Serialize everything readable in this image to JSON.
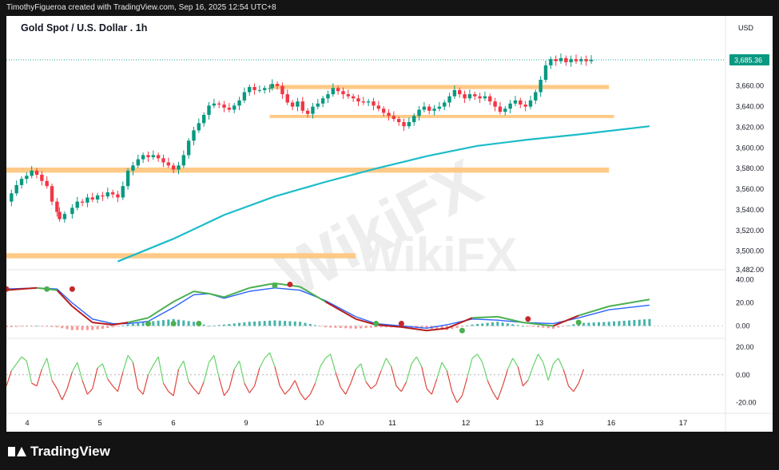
{
  "header": {
    "attribution": "TimothyFigueroa created with TradingView.com, Sep 16, 2025 12:54 UTC+8"
  },
  "footer": {
    "brand": "TradingView"
  },
  "watermark": {
    "text": "WikiFX"
  },
  "chart_data": [
    {
      "type": "candlestick",
      "title": "Gold Spot / U.S. Dollar . 1h",
      "currency_label": "USD",
      "ylim": [
        3482,
        3700
      ],
      "y_ticks": [
        "3,660.00",
        "3,640.00",
        "3,620.00",
        "3,600.00",
        "3,580.00",
        "3,560.00",
        "3,540.00",
        "3,520.00",
        "3,500.00",
        "3,482.00"
      ],
      "last_price": "3,685.36",
      "last_price_value": 3685.36,
      "x_ticks": [
        "4",
        "5",
        "6",
        "9",
        "10",
        "11",
        "12",
        "13",
        "16",
        "17"
      ],
      "xlim": [
        3.7,
        17.9
      ],
      "zones": [
        {
          "x_from": 8.9,
          "x_to": 15.6,
          "y_low": 3657,
          "y_high": 3661,
          "color": "#ffc47a"
        },
        {
          "x_from": 8.9,
          "x_to": 15.7,
          "y_low": 3629,
          "y_high": 3632,
          "color": "#ffc47a"
        },
        {
          "x_from": 3.7,
          "x_to": 15.6,
          "y_low": 3576,
          "y_high": 3581,
          "color": "#ffc47a"
        },
        {
          "x_from": 3.7,
          "x_to": 10.6,
          "y_low": 3493,
          "y_high": 3498,
          "color": "#ffc47a"
        }
      ],
      "moving_average": {
        "color": "#1bbcc8",
        "points": [
          [
            5.9,
            3490
          ],
          [
            7,
            3512
          ],
          [
            8,
            3535
          ],
          [
            9,
            3553
          ],
          [
            10,
            3567
          ],
          [
            11,
            3580
          ],
          [
            12,
            3592
          ],
          [
            13,
            3602
          ],
          [
            14,
            3608
          ],
          [
            15,
            3613
          ],
          [
            16.4,
            3621
          ]
        ]
      },
      "price_path": [
        [
          3.7,
          3548
        ],
        [
          3.8,
          3556
        ],
        [
          3.9,
          3564
        ],
        [
          4.0,
          3570
        ],
        [
          4.1,
          3573
        ],
        [
          4.2,
          3578
        ],
        [
          4.3,
          3574
        ],
        [
          4.4,
          3568
        ],
        [
          4.5,
          3563
        ],
        [
          4.6,
          3548
        ],
        [
          4.7,
          3538
        ],
        [
          4.75,
          3531
        ],
        [
          4.85,
          3536
        ],
        [
          5.0,
          3542
        ],
        [
          5.1,
          3548
        ],
        [
          5.2,
          3547
        ],
        [
          5.3,
          3552
        ],
        [
          5.4,
          3550
        ],
        [
          5.5,
          3554
        ],
        [
          5.6,
          3553
        ],
        [
          5.7,
          3557
        ],
        [
          5.8,
          3555
        ],
        [
          5.9,
          3552
        ],
        [
          6.0,
          3563
        ],
        [
          6.1,
          3578
        ],
        [
          6.2,
          3583
        ],
        [
          6.3,
          3589
        ],
        [
          6.4,
          3593
        ],
        [
          6.5,
          3591
        ],
        [
          6.6,
          3593
        ],
        [
          6.7,
          3590
        ],
        [
          6.8,
          3586
        ],
        [
          6.9,
          3583
        ],
        [
          7.0,
          3579
        ],
        [
          7.1,
          3583
        ],
        [
          7.2,
          3593
        ],
        [
          7.3,
          3607
        ],
        [
          7.4,
          3617
        ],
        [
          7.5,
          3624
        ],
        [
          7.6,
          3632
        ],
        [
          7.7,
          3641
        ],
        [
          7.8,
          3643
        ],
        [
          7.9,
          3642
        ],
        [
          8.0,
          3639
        ],
        [
          8.1,
          3637
        ],
        [
          8.2,
          3641
        ],
        [
          8.3,
          3646
        ],
        [
          8.4,
          3654
        ],
        [
          8.5,
          3659
        ],
        [
          8.6,
          3656
        ],
        [
          8.7,
          3656
        ],
        [
          8.8,
          3658
        ],
        [
          8.9,
          3658
        ],
        [
          8.95,
          3662
        ],
        [
          9.05,
          3660
        ],
        [
          9.15,
          3652
        ],
        [
          9.25,
          3644
        ],
        [
          9.35,
          3640
        ],
        [
          9.45,
          3645
        ],
        [
          9.55,
          3636
        ],
        [
          9.65,
          3633
        ],
        [
          9.75,
          3640
        ],
        [
          9.85,
          3643
        ],
        [
          9.95,
          3648
        ],
        [
          10.05,
          3652
        ],
        [
          10.15,
          3658
        ],
        [
          10.25,
          3655
        ],
        [
          10.35,
          3652
        ],
        [
          10.45,
          3650
        ],
        [
          10.55,
          3648
        ],
        [
          10.65,
          3645
        ],
        [
          10.75,
          3644
        ],
        [
          10.85,
          3645
        ],
        [
          10.95,
          3641
        ],
        [
          11.05,
          3638
        ],
        [
          11.15,
          3634
        ],
        [
          11.25,
          3631
        ],
        [
          11.35,
          3628
        ],
        [
          11.45,
          3625
        ],
        [
          11.55,
          3621
        ],
        [
          11.65,
          3625
        ],
        [
          11.75,
          3631
        ],
        [
          11.85,
          3637
        ],
        [
          11.95,
          3640
        ],
        [
          12.05,
          3636
        ],
        [
          12.15,
          3638
        ],
        [
          12.25,
          3640
        ],
        [
          12.35,
          3644
        ],
        [
          12.45,
          3650
        ],
        [
          12.55,
          3656
        ],
        [
          12.65,
          3652
        ],
        [
          12.75,
          3648
        ],
        [
          12.85,
          3652
        ],
        [
          12.95,
          3650
        ],
        [
          13.05,
          3648
        ],
        [
          13.15,
          3650
        ],
        [
          13.25,
          3645
        ],
        [
          13.35,
          3640
        ],
        [
          13.45,
          3635
        ],
        [
          13.55,
          3638
        ],
        [
          13.65,
          3643
        ],
        [
          13.75,
          3646
        ],
        [
          13.85,
          3642
        ],
        [
          13.95,
          3640
        ],
        [
          14.05,
          3646
        ],
        [
          14.15,
          3654
        ],
        [
          14.25,
          3666
        ],
        [
          14.35,
          3680
        ],
        [
          14.45,
          3686
        ],
        [
          14.55,
          3684
        ],
        [
          14.65,
          3687
        ],
        [
          14.75,
          3683
        ],
        [
          14.85,
          3686
        ],
        [
          14.95,
          3684
        ],
        [
          15.05,
          3686
        ],
        [
          15.15,
          3684
        ],
        [
          15.25,
          3685.4
        ]
      ]
    },
    {
      "type": "line+histogram",
      "y_ticks": [
        "40.00",
        "20.00",
        "0.00"
      ],
      "ylim": [
        -8,
        46
      ],
      "signal_line": [
        [
          3.7,
          32
        ],
        [
          4.3,
          33
        ],
        [
          4.7,
          32
        ],
        [
          5.0,
          20
        ],
        [
          5.4,
          6
        ],
        [
          5.8,
          2
        ],
        [
          6.1,
          2
        ],
        [
          6.5,
          4
        ],
        [
          7.0,
          16
        ],
        [
          7.4,
          27
        ],
        [
          7.7,
          28
        ],
        [
          8.0,
          24
        ],
        [
          8.5,
          30
        ],
        [
          9.0,
          33
        ],
        [
          9.5,
          31
        ],
        [
          10.0,
          22
        ],
        [
          10.6,
          8
        ],
        [
          11.0,
          2
        ],
        [
          11.5,
          0
        ],
        [
          12.0,
          -2
        ],
        [
          12.4,
          1
        ],
        [
          12.9,
          6
        ],
        [
          13.4,
          5
        ],
        [
          13.9,
          3
        ],
        [
          14.5,
          2
        ],
        [
          15.0,
          7
        ],
        [
          15.6,
          14
        ],
        [
          16.4,
          18
        ]
      ],
      "fast_line": [
        [
          3.7,
          31
        ],
        [
          4.3,
          33
        ],
        [
          4.7,
          31
        ],
        [
          5.0,
          17
        ],
        [
          5.4,
          3
        ],
        [
          5.8,
          1
        ],
        [
          6.1,
          3
        ],
        [
          6.5,
          7
        ],
        [
          7.0,
          21
        ],
        [
          7.4,
          30
        ],
        [
          7.7,
          28
        ],
        [
          8.0,
          25
        ],
        [
          8.5,
          33
        ],
        [
          9.0,
          37
        ],
        [
          9.5,
          34
        ],
        [
          10.0,
          21
        ],
        [
          10.6,
          6
        ],
        [
          11.0,
          1
        ],
        [
          11.5,
          -1
        ],
        [
          12.0,
          -4
        ],
        [
          12.4,
          -2
        ],
        [
          12.9,
          7
        ],
        [
          13.4,
          8
        ],
        [
          13.9,
          3
        ],
        [
          14.5,
          0
        ],
        [
          15.0,
          9
        ],
        [
          15.6,
          17
        ],
        [
          16.4,
          23
        ]
      ],
      "markers": [
        [
          3.7,
          32,
          "#c62828"
        ],
        [
          4.5,
          32,
          "#4caf50"
        ],
        [
          5.0,
          32,
          "#c62828"
        ],
        [
          6.5,
          2,
          "#4caf50"
        ],
        [
          7.0,
          2,
          "#4caf50"
        ],
        [
          7.5,
          2,
          "#4caf50"
        ],
        [
          9.0,
          35,
          "#4caf50"
        ],
        [
          9.3,
          36,
          "#c62828"
        ],
        [
          11.0,
          2,
          "#4caf50"
        ],
        [
          11.5,
          2,
          "#c62828"
        ],
        [
          12.7,
          -4,
          "#4caf50"
        ],
        [
          14.0,
          6,
          "#c62828"
        ],
        [
          15.0,
          3,
          "#4caf50"
        ]
      ]
    },
    {
      "type": "line",
      "y_ticks": [
        "20.00",
        "0.00",
        "-20.00"
      ],
      "ylim": [
        -26,
        24
      ],
      "zero_line": 0,
      "values": [
        [
          3.7,
          -8
        ],
        [
          3.8,
          3
        ],
        [
          3.9,
          8
        ],
        [
          4.0,
          13
        ],
        [
          4.1,
          10
        ],
        [
          4.2,
          -6
        ],
        [
          4.3,
          -8
        ],
        [
          4.4,
          4
        ],
        [
          4.5,
          12
        ],
        [
          4.6,
          -4
        ],
        [
          4.7,
          -10
        ],
        [
          4.8,
          -18
        ],
        [
          4.9,
          -10
        ],
        [
          5.0,
          2
        ],
        [
          5.1,
          9
        ],
        [
          5.2,
          -4
        ],
        [
          5.3,
          -14
        ],
        [
          5.4,
          -10
        ],
        [
          5.5,
          5
        ],
        [
          5.6,
          8
        ],
        [
          5.7,
          -3
        ],
        [
          5.8,
          -8
        ],
        [
          5.9,
          -12
        ],
        [
          6.0,
          2
        ],
        [
          6.1,
          14
        ],
        [
          6.2,
          9
        ],
        [
          6.3,
          -10
        ],
        [
          6.4,
          -14
        ],
        [
          6.5,
          0
        ],
        [
          6.6,
          7
        ],
        [
          6.7,
          13
        ],
        [
          6.8,
          -6
        ],
        [
          6.9,
          -12
        ],
        [
          7.0,
          -15
        ],
        [
          7.1,
          4
        ],
        [
          7.2,
          10
        ],
        [
          7.3,
          -5
        ],
        [
          7.4,
          -10
        ],
        [
          7.5,
          -14
        ],
        [
          7.6,
          -5
        ],
        [
          7.7,
          9
        ],
        [
          7.8,
          14
        ],
        [
          7.9,
          -2
        ],
        [
          8.0,
          -15
        ],
        [
          8.1,
          -10
        ],
        [
          8.2,
          4
        ],
        [
          8.3,
          10
        ],
        [
          8.4,
          -6
        ],
        [
          8.5,
          -13
        ],
        [
          8.6,
          -8
        ],
        [
          8.7,
          5
        ],
        [
          8.8,
          12
        ],
        [
          8.9,
          16
        ],
        [
          9.0,
          6
        ],
        [
          9.1,
          -8
        ],
        [
          9.2,
          -14
        ],
        [
          9.3,
          -10
        ],
        [
          9.4,
          -4
        ],
        [
          9.5,
          -13
        ],
        [
          9.6,
          -18
        ],
        [
          9.7,
          -14
        ],
        [
          9.8,
          -6
        ],
        [
          9.9,
          6
        ],
        [
          10.0,
          12
        ],
        [
          10.1,
          15
        ],
        [
          10.2,
          2
        ],
        [
          10.3,
          -9
        ],
        [
          10.4,
          -14
        ],
        [
          10.5,
          -6
        ],
        [
          10.6,
          4
        ],
        [
          10.7,
          8
        ],
        [
          10.8,
          -5
        ],
        [
          10.9,
          -10
        ],
        [
          11.0,
          -7
        ],
        [
          11.1,
          3
        ],
        [
          11.2,
          12
        ],
        [
          11.3,
          6
        ],
        [
          11.4,
          -8
        ],
        [
          11.5,
          -12
        ],
        [
          11.6,
          -5
        ],
        [
          11.7,
          8
        ],
        [
          11.8,
          13
        ],
        [
          11.9,
          6
        ],
        [
          12.0,
          -10
        ],
        [
          12.1,
          -14
        ],
        [
          12.2,
          -3
        ],
        [
          12.3,
          9
        ],
        [
          12.4,
          3
        ],
        [
          12.5,
          -12
        ],
        [
          12.6,
          -20
        ],
        [
          12.7,
          -15
        ],
        [
          12.8,
          -2
        ],
        [
          12.9,
          12
        ],
        [
          13.0,
          15
        ],
        [
          13.1,
          9
        ],
        [
          13.2,
          -4
        ],
        [
          13.3,
          -12
        ],
        [
          13.4,
          -18
        ],
        [
          13.5,
          -8
        ],
        [
          13.6,
          4
        ],
        [
          13.7,
          12
        ],
        [
          13.8,
          6
        ],
        [
          13.9,
          -8
        ],
        [
          14.0,
          -4
        ],
        [
          14.1,
          6
        ],
        [
          14.2,
          15
        ],
        [
          14.3,
          9
        ],
        [
          14.4,
          -4
        ],
        [
          14.5,
          8
        ],
        [
          14.6,
          12
        ],
        [
          14.7,
          4
        ],
        [
          14.8,
          -8
        ],
        [
          14.9,
          -12
        ],
        [
          15.0,
          -6
        ],
        [
          15.1,
          4
        ]
      ]
    }
  ]
}
